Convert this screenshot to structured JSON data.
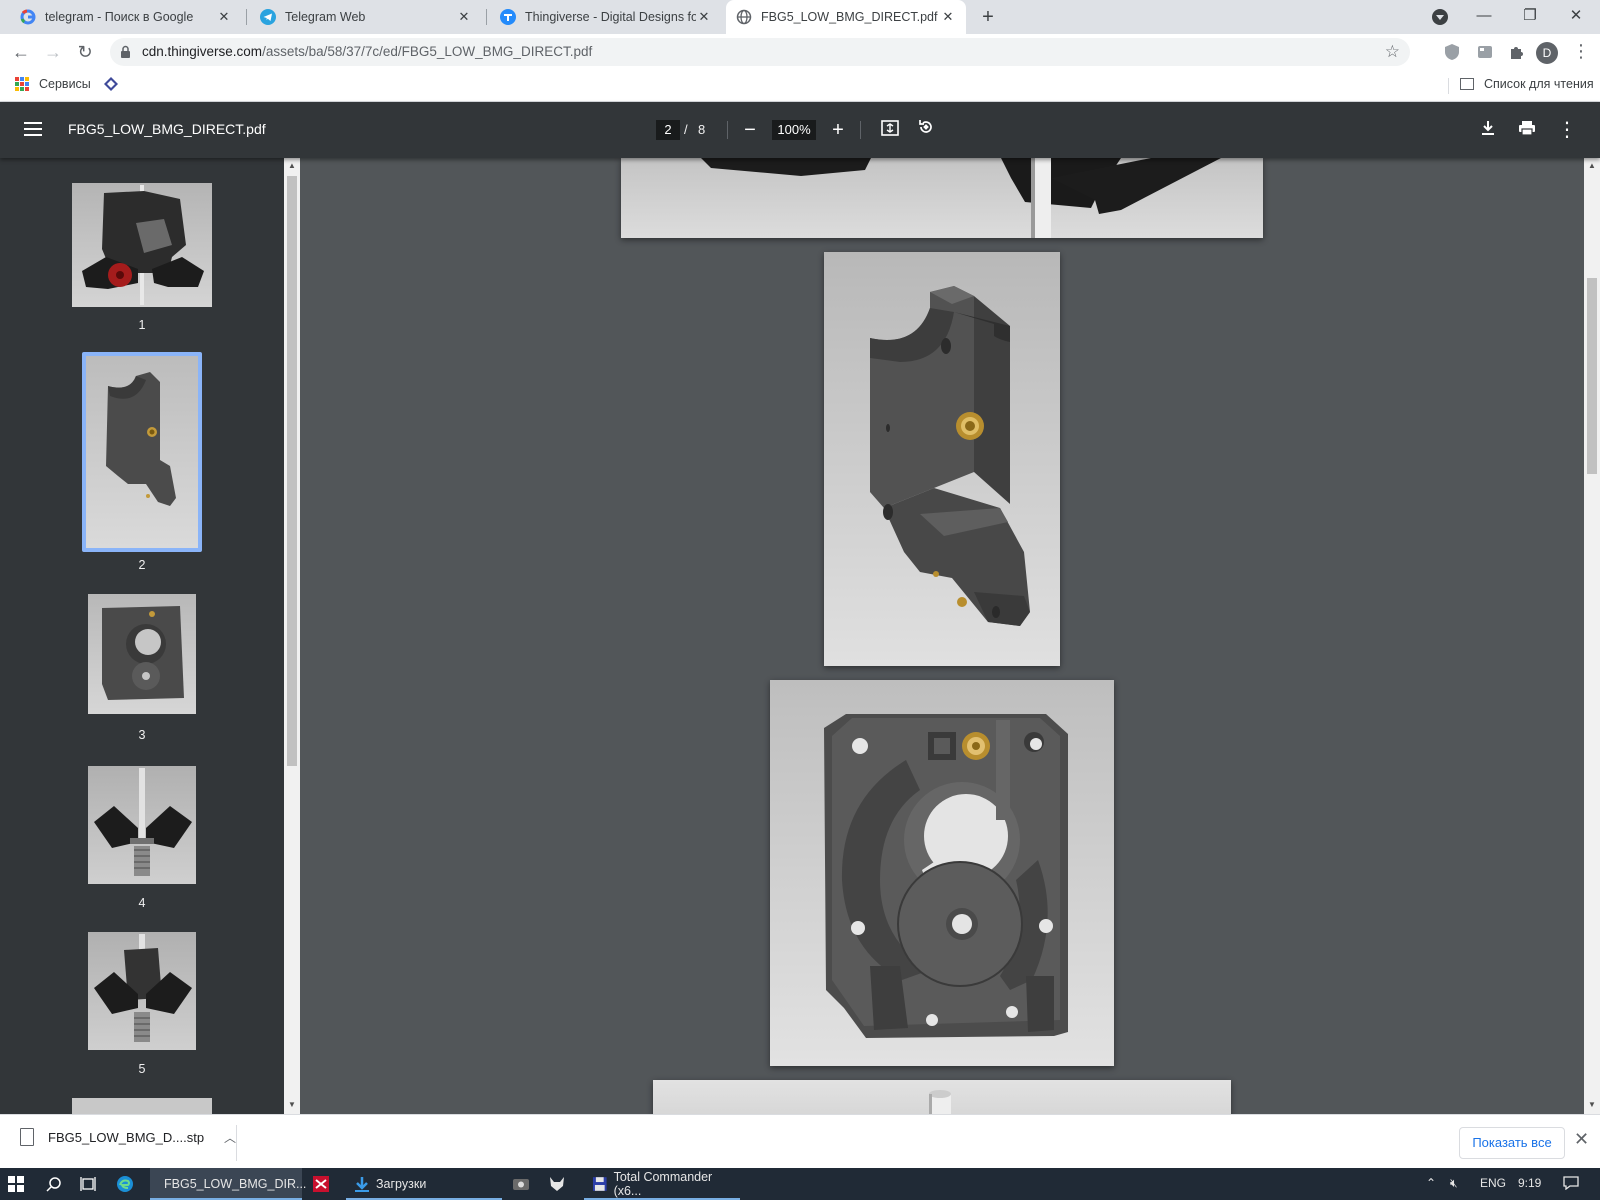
{
  "browser": {
    "tabs": [
      {
        "title": "telegram - Поиск в Google",
        "icon": "google-icon"
      },
      {
        "title": "Telegram Web",
        "icon": "telegram-icon"
      },
      {
        "title": "Thingiverse - Digital Designs for P",
        "icon": "thingiverse-icon"
      },
      {
        "title": "FBG5_LOW_BMG_DIRECT.pdf",
        "icon": "globe-icon",
        "active": true
      }
    ],
    "url_host": "cdn.thingiverse.com",
    "url_path": "/assets/ba/58/37/7c/ed/FBG5_LOW_BMG_DIRECT.pdf",
    "profile_initial": "D",
    "bookmarks": {
      "apps_label": "Сервисы",
      "reading_list": "Список для чтения"
    }
  },
  "pdf": {
    "title": "FBG5_LOW_BMG_DIRECT.pdf",
    "current_page": "2",
    "page_sep": "/",
    "total_pages": "8",
    "zoom": "100%",
    "thumbnails": [
      {
        "label": "1"
      },
      {
        "label": "2",
        "selected": true
      },
      {
        "label": "3"
      },
      {
        "label": "4"
      },
      {
        "label": "5"
      }
    ]
  },
  "downloads": {
    "item": "FBG5_LOW_BMG_D....stp",
    "show_all": "Показать все"
  },
  "taskbar": {
    "items": [
      {
        "label": "FBG5_LOW_BMG_DIR...",
        "icon": "chrome-icon",
        "active": true
      },
      {
        "label": "Загрузки",
        "icon": "download-folder-icon"
      },
      {
        "label": "Total Commander (x6...",
        "icon": "total-commander-icon"
      }
    ],
    "lang": "ENG",
    "time": "9:19"
  },
  "colors": {
    "viewer_bg": "#525659",
    "toolbar_bg": "#323639",
    "thumb_selected": "#8ab4f8",
    "link_blue": "#1a73e8"
  }
}
